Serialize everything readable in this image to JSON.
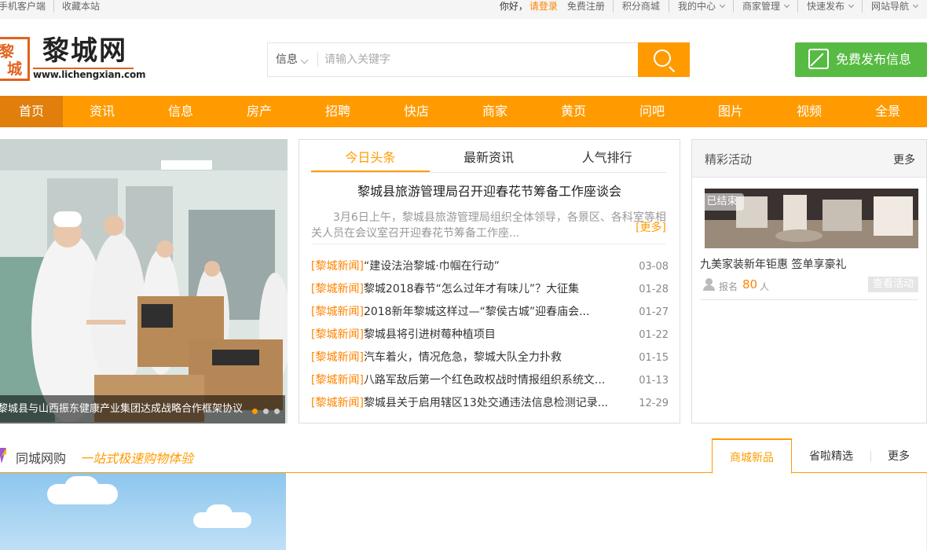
{
  "topbar": {
    "mobile": "手机客户端",
    "favorite": "收藏本站",
    "hello": "你好，",
    "login": "请登录",
    "register": "免费注册",
    "menus": [
      "积分商城",
      "我的中心",
      "商家管理",
      "快速发布",
      "网站导航"
    ]
  },
  "logo": {
    "seal_chars": [
      "黎",
      "城"
    ],
    "brand": "黎城网",
    "url": "www.lichengxian.com"
  },
  "search": {
    "category": "信息",
    "placeholder": "请输入关键字"
  },
  "publish_label": "免费发布信息",
  "nav": [
    "首页",
    "资讯",
    "信息",
    "房产",
    "招聘",
    "快店",
    "商家",
    "黄页",
    "问吧",
    "图片",
    "视频",
    "全景"
  ],
  "carousel": {
    "caption": "黎城县与山西振东健康产业集团达成战略合作框架协议",
    "slide_count": 3,
    "active_slide": 1
  },
  "news": {
    "tabs": [
      "今日头条",
      "最新资讯",
      "人气排行"
    ],
    "active_tab": 0,
    "headline": "黎城县旅游管理局召开迎春花节筹备工作座谈会",
    "summary": "3月6日上午，黎城县旅游管理局组织全体领导，各景区、各科室等相关人员在会议室召开迎春花节筹备工作座...",
    "more": "[更多]",
    "items": [
      {
        "tag": "[黎城新闻]",
        "title": "“建设法治黎城·巾帼在行动”",
        "date": "03-08"
      },
      {
        "tag": "[黎城新闻]",
        "title": "黎城2018春节“怎么过年才有味儿”？大征集",
        "date": "01-28"
      },
      {
        "tag": "[黎城新闻]",
        "title": "2018新年黎城这样过—“黎侯古城”迎春庙会...",
        "date": "01-27"
      },
      {
        "tag": "[黎城新闻]",
        "title": "黎城县将引进树莓种植项目",
        "date": "01-22"
      },
      {
        "tag": "[黎城新闻]",
        "title": "汽车着火，情况危急，黎城大队全力扑救",
        "date": "01-15"
      },
      {
        "tag": "[黎城新闻]",
        "title": "八路军敌后第一个红色政权战时情报组织系统文...",
        "date": "01-13"
      },
      {
        "tag": "[黎城新闻]",
        "title": "黎城县关于启用辖区13处交通违法信息检测记录...",
        "date": "12-29"
      }
    ]
  },
  "activity": {
    "title": "精彩活动",
    "more": "更多",
    "status_tag": "已结束",
    "name": "九美家装新年钜惠 签单享豪礼",
    "signup_label": "报名",
    "signup_count": "80",
    "signup_unit": "人",
    "view_button": "查看活动"
  },
  "shop": {
    "title": "同城网购",
    "slogan": "一站式极速购物体验",
    "tabs": [
      "商城新品",
      "省啦精选",
      "更多"
    ],
    "active_tab": 0
  },
  "colors": {
    "accent": "#ff9b00",
    "nav_active": "#e07f0c",
    "publish_green": "#57bb43",
    "news_tag": "#ff8400"
  }
}
